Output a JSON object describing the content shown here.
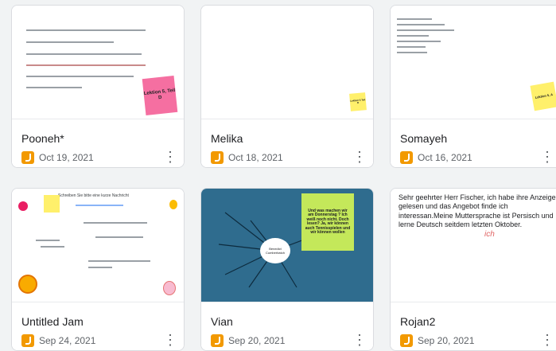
{
  "cards": [
    {
      "title": "Pooneh*",
      "date": "Oct 19, 2021",
      "sticky": "Lektion 5, Teil D"
    },
    {
      "title": "Melika",
      "date": "Oct 18, 2021",
      "sticky": "Lektion 5 Teil D"
    },
    {
      "title": "Somayeh",
      "date": "Oct 16, 2021",
      "sticky": "Lektion 5, A"
    },
    {
      "title": "Untitled Jam",
      "date": "Sep 24, 2021",
      "sticky": "Schreiben Sie bitte eine kurze Nachricht"
    },
    {
      "title": "Vian",
      "date": "Sep 20, 2021",
      "sticky": "Und was machen wir am Donnerstag ? Ich weiß noch nicht. Doch lesen? Ja, wir können auch Tennisspielen und wir können wollen",
      "center": "Benedict Cumberbatch"
    },
    {
      "title": "Rojan2",
      "date": "Sep 20, 2021",
      "letter": "Sehr geehrter Herr Fischer,\nich habe ihre Anzeige gelesen und das Angebot finde ich interessan.Meine Muttersprache ist Persisch und lerne Deutsch seitdem letzten Oktober.",
      "scribble": "ich"
    }
  ],
  "more_symbol": "⋮",
  "colors": {
    "jam_orange": "#f29900",
    "pink_sticky": "#f56fa1",
    "yellow_sticky": "#fff06b",
    "green_sticky": "#c4e85a",
    "board_blue": "#2f6c8e"
  }
}
